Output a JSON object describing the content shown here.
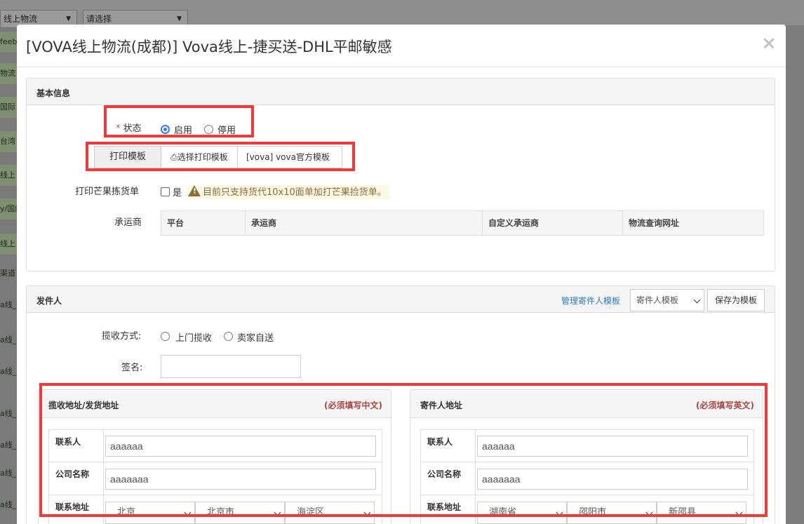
{
  "background": {
    "select_1": "线上物流",
    "select_2": "请选择",
    "side_items": [
      "feeb",
      "物流",
      "国际",
      "台湾",
      "线上",
      "y/国内",
      "线上",
      "渠道",
      "a线_敏感",
      "a线_全程",
      "a线_",
      "a线_速捷",
      "a线_",
      "a线_",
      "a线_S"
    ]
  },
  "modal": {
    "title": "[VOVA线上物流(成都)] Vova线上-捷买送-DHL平邮敏感",
    "close": "×"
  },
  "basic_info": {
    "title": "基本信息",
    "status": {
      "required_mark": "*",
      "label": "状态",
      "options": [
        {
          "label": "启用",
          "checked": true
        },
        {
          "label": "停用",
          "checked": false
        }
      ]
    },
    "print_template": {
      "label": "打印模板",
      "button": "选择打印模板",
      "value": "[vova] vova官方模板"
    },
    "mango_pick": {
      "label": "打印芒果拣货单",
      "checkbox_label": "是",
      "warning": "目前只支持货代10x10面单加打芒果捡货单。"
    },
    "carrier": {
      "label": "承运商",
      "columns": [
        "平台",
        "承运商",
        "自定义承运商",
        "物流查询网址"
      ]
    }
  },
  "sender": {
    "title": "发件人",
    "manage_link": "管理寄件人模板",
    "template_select": "寄件人模板",
    "save_template": "保存为模板",
    "pickup_method": {
      "label": "揽收方式:",
      "options": [
        {
          "label": "上门揽收",
          "checked": false
        },
        {
          "label": "卖家自送",
          "checked": false
        }
      ]
    },
    "signature": {
      "label": "签名:",
      "value": ""
    },
    "pickup_address": {
      "title": "揽收地址/发货地址",
      "note": "(必须填写中文)",
      "contact_label": "联系人",
      "contact_value": "aaaaaa",
      "company_label": "公司名称",
      "company_value": "aaaaaaa",
      "address_label": "联系地址",
      "province": "北京",
      "city": "北京市",
      "district": "海淀区"
    },
    "return_address": {
      "title": "寄件人地址",
      "note": "(必须填写英文)",
      "contact_label": "联系人",
      "contact_value": "aaaaaa",
      "company_label": "公司名称",
      "company_value": "aaaaaaa",
      "address_label": "联系地址",
      "province": "湖南省",
      "city": "邵阳市",
      "district": "新邵县"
    }
  },
  "colors": {
    "highlight": "#f03a3a",
    "link": "#2a7bbf",
    "required": "#d9534f",
    "warning_text": "#8a6d3b",
    "warning_bg": "#fcf8e3",
    "note": "#a94442"
  }
}
